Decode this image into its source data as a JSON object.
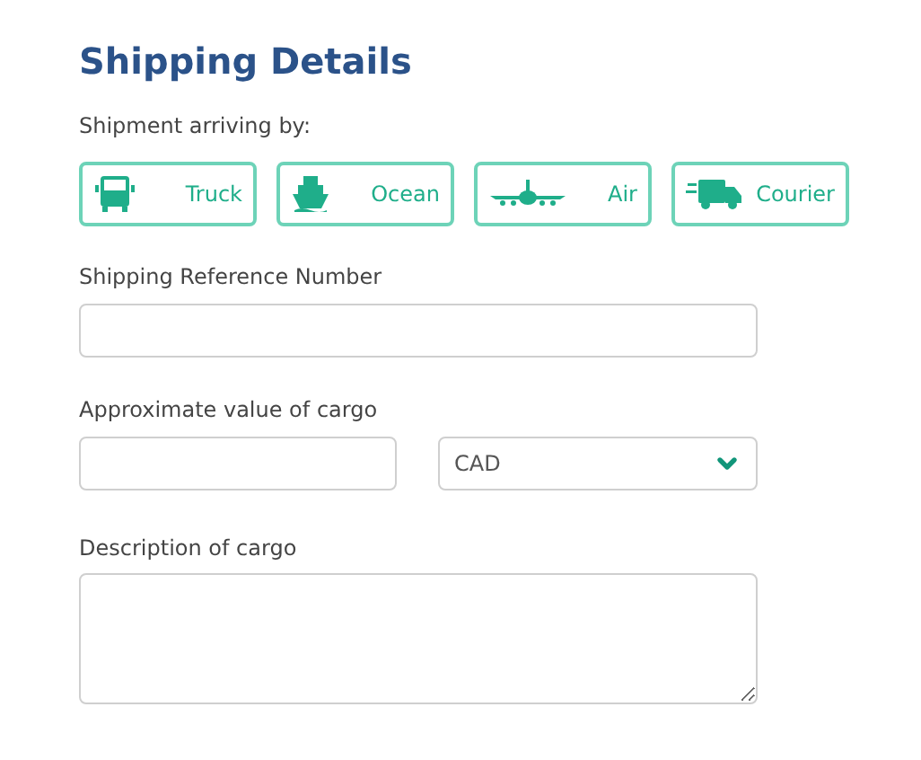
{
  "title": "Shipping Details",
  "arrival": {
    "label": "Shipment arriving by:",
    "options": [
      {
        "kind": "truck",
        "label": "Truck"
      },
      {
        "kind": "ocean",
        "label": "Ocean"
      },
      {
        "kind": "air",
        "label": "Air"
      },
      {
        "kind": "courier",
        "label": "Courier"
      }
    ]
  },
  "reference": {
    "label": "Shipping Reference Number"
  },
  "cargo_value": {
    "label": "Approximate value of cargo",
    "currency": "CAD"
  },
  "description": {
    "label": "Description of cargo"
  }
}
